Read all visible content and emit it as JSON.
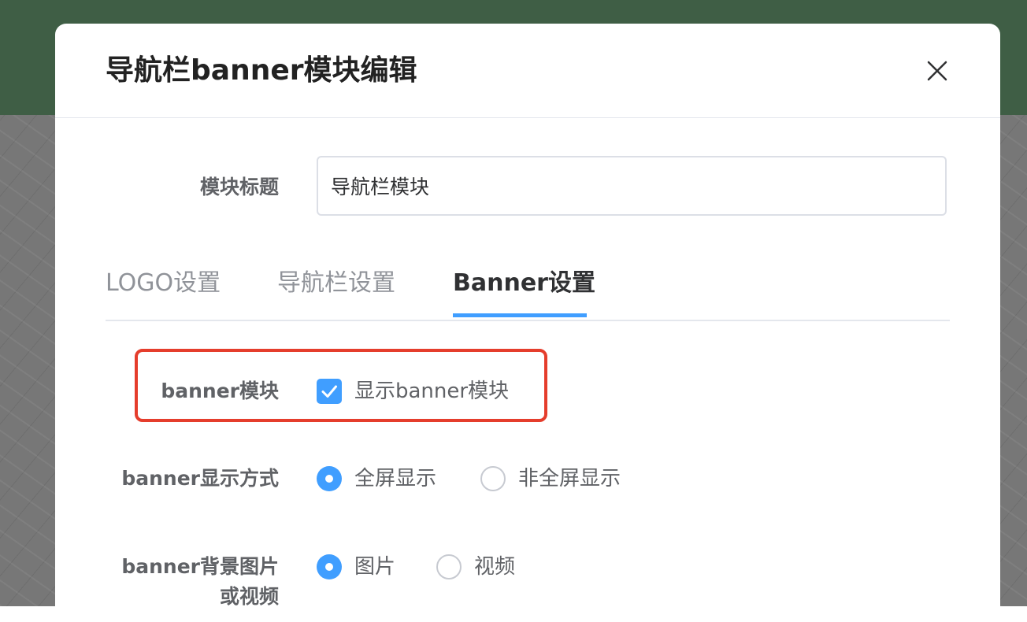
{
  "modal": {
    "title": "导航栏banner模块编辑",
    "close_icon": "close-icon"
  },
  "form": {
    "module_title": {
      "label": "模块标题",
      "value": "导航栏模块"
    },
    "tabs": [
      {
        "label": "LOGO设置",
        "active": false
      },
      {
        "label": "导航栏设置",
        "active": false
      },
      {
        "label": "Banner设置",
        "active": true
      }
    ],
    "banner_module": {
      "label": "banner模块",
      "checkbox_label": "显示banner模块",
      "checked": true
    },
    "banner_display": {
      "label": "banner显示方式",
      "options": [
        {
          "label": "全屏显示",
          "checked": true
        },
        {
          "label": "非全屏显示",
          "checked": false
        }
      ]
    },
    "banner_background": {
      "label_line1": "banner背景图片",
      "label_line2": "或视频",
      "options": [
        {
          "label": "图片",
          "checked": true
        },
        {
          "label": "视频",
          "checked": false
        }
      ]
    }
  },
  "colors": {
    "primary": "#409eff",
    "highlight_border": "#e53d2c",
    "header_background": "#3f5e45"
  }
}
